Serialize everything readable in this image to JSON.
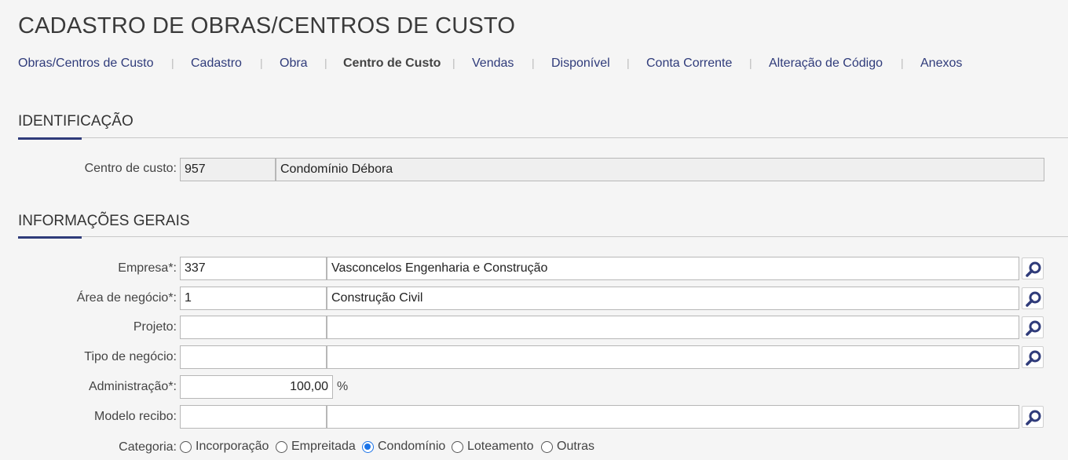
{
  "page_title": "CADASTRO DE OBRAS/CENTROS DE CUSTO",
  "nav": {
    "items": [
      {
        "label": "Obras/Centros de Custo"
      },
      {
        "label": "Cadastro"
      },
      {
        "label": "Obra"
      },
      {
        "label": "Centro de Custo"
      },
      {
        "label": "Vendas"
      },
      {
        "label": "Disponível"
      },
      {
        "label": "Conta Corrente"
      },
      {
        "label": "Alteração de Código"
      },
      {
        "label": "Anexos"
      }
    ],
    "active": "Centro de Custo",
    "separator": "|"
  },
  "identificacao": {
    "title": "IDENTIFICAÇÃO",
    "centro_custo": {
      "label": "Centro de custo:",
      "code": "957",
      "name": "Condomínio Débora"
    }
  },
  "informacoes_gerais": {
    "title": "INFORMAÇÕES GERAIS",
    "empresa": {
      "label": "Empresa*:",
      "code": "337",
      "name": "Vasconcelos Engenharia e Construção"
    },
    "area_negocio": {
      "label": "Área de negócio*:",
      "code": "1",
      "name": "Construção Civil"
    },
    "projeto": {
      "label": "Projeto:",
      "code": "",
      "name": ""
    },
    "tipo_negocio": {
      "label": "Tipo de negócio:",
      "code": "",
      "name": ""
    },
    "administracao": {
      "label": "Administração*:",
      "value": "100,00",
      "unit": "%"
    },
    "modelo_recibo": {
      "label": "Modelo recibo:",
      "code": "",
      "name": ""
    },
    "categoria": {
      "label": "Categoria:",
      "options": [
        "Incorporação",
        "Empreitada",
        "Condomínio",
        "Loteamento",
        "Outras"
      ],
      "selected": "Condomínio"
    }
  },
  "icons": {
    "lookup": "search-icon"
  },
  "colors": {
    "accent": "#2f3b7a",
    "radio_selected": "#1a73e8"
  }
}
